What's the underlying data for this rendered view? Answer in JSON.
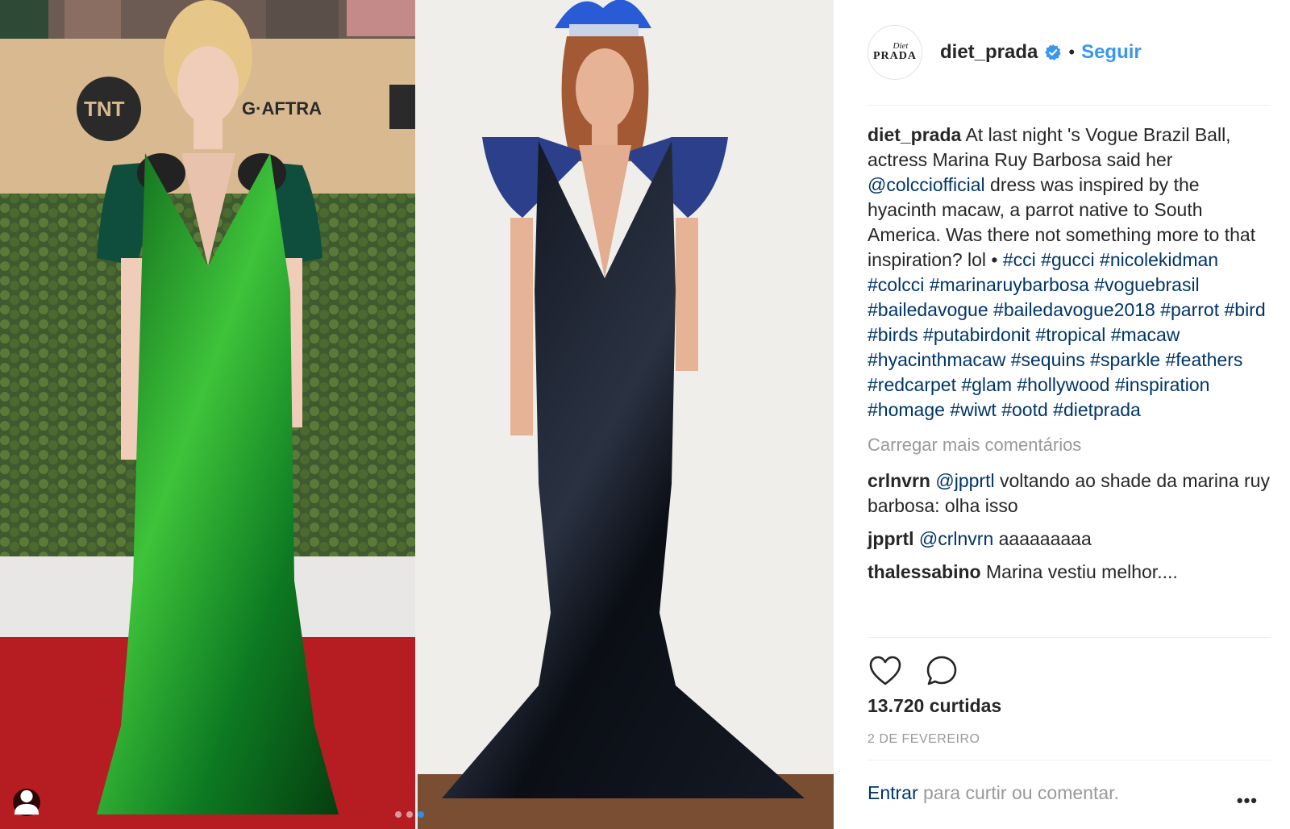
{
  "post": {
    "username": "diet_prada",
    "follow_label": "Seguir",
    "separator": "•",
    "avatar_text_top": "Diet",
    "avatar_text_bottom": "PRADA"
  },
  "caption": {
    "username": "diet_prada",
    "text_1": "At last night 's Vogue Brazil Ball, actress Marina Ruy Barbosa said her",
    "mention": "@colcciofficial",
    "text_2": "dress was inspired by the hyacinth macaw, a parrot native to South America.  Was there not something more to that inspiration? lol •",
    "hashtags": "#cci #gucci #nicolekidman #colcci #marinaruybarbosa #voguebrasil #bailedavogue #bailedavogue2018 #parrot #bird #birds #putabirdonit #tropical #macaw #hyacinthmacaw #sequins #sparkle #feathers #redcarpet #glam #hollywood #inspiration #homage #wiwt #ootd #dietprada"
  },
  "load_more_label": "Carregar mais comentários",
  "comments": [
    {
      "user": "crlnvrn",
      "mention": "@jpprtl",
      "text": "voltando ao shade da marina ruy barbosa: olha isso"
    },
    {
      "user": "jpprtl",
      "mention": "@crlnvrn",
      "text": "aaaaaaaaa"
    },
    {
      "user": "thalessabino",
      "mention": "",
      "text": "Marina vestiu melhor...."
    }
  ],
  "likes": "13.720 curtidas",
  "date": "2 DE FEVEREIRO",
  "login": {
    "enter": "Entrar",
    "rest": "para curtir ou comentar."
  },
  "more_label": "•••",
  "icons": {
    "like": "heart-icon",
    "comment": "comment-icon",
    "verified": "verified-badge-icon",
    "user_tags": "user-tag-icon"
  },
  "colors": {
    "follow": "#3897f0",
    "link": "#003569",
    "muted": "#999999",
    "carousel_active": "#2f8ee6"
  },
  "carousel": {
    "dots": 3,
    "active_index": 2
  }
}
